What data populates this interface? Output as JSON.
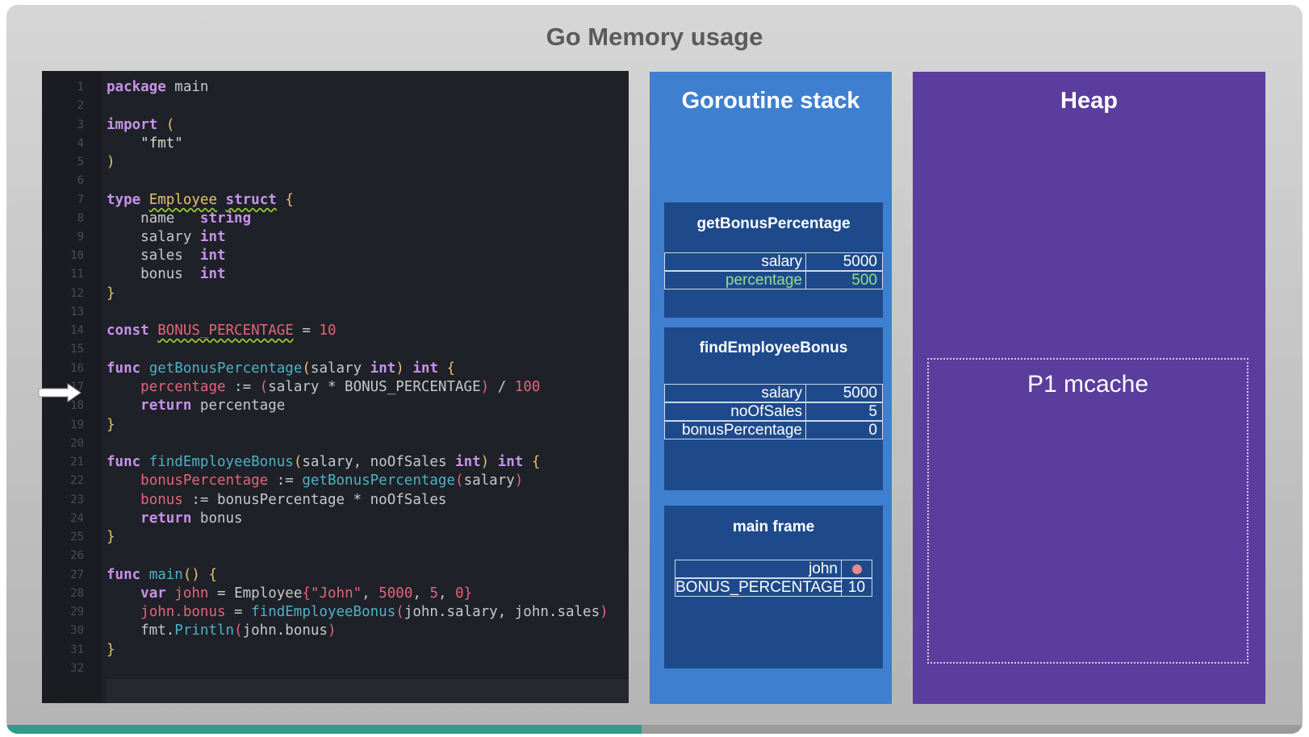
{
  "title": "Go Memory usage",
  "code": {
    "line_numbers": [
      "1",
      "2",
      "3",
      "4",
      "5",
      "6",
      "7",
      "8",
      "9",
      "10",
      "11",
      "12",
      "13",
      "14",
      "15",
      "16",
      "17",
      "18",
      "19",
      "20",
      "21",
      "22",
      "23",
      "24",
      "25",
      "26",
      "27",
      "28",
      "29",
      "30",
      "31",
      "32"
    ]
  },
  "stack": {
    "title": "Goroutine stack",
    "frames": [
      {
        "name": "getBonusPercentage",
        "rows": [
          {
            "key": "salary",
            "value": "5000"
          },
          {
            "key": "percentage",
            "value": "500"
          }
        ]
      },
      {
        "name": "findEmployeeBonus",
        "rows": [
          {
            "key": "salary",
            "value": "5000"
          },
          {
            "key": "noOfSales",
            "value": "5"
          },
          {
            "key": "bonusPercentage",
            "value": "0"
          }
        ]
      },
      {
        "name": "main frame",
        "rows": [
          {
            "key": "john",
            "value": ""
          },
          {
            "key": "BONUS_PERCENTAGE",
            "value": "10"
          }
        ]
      }
    ]
  },
  "heap": {
    "title": "Heap",
    "mcache_label": "P1 mcache"
  },
  "progress": {
    "fraction": 0.49
  },
  "colors": {
    "stack_bg": "#3f7fd0",
    "frame_bg": "#1e4a8c",
    "heap_bg": "#5b3d9e",
    "code_bg": "#1f2128",
    "highlight_green": "#8ee08a",
    "progress": "#2f9b8d"
  }
}
